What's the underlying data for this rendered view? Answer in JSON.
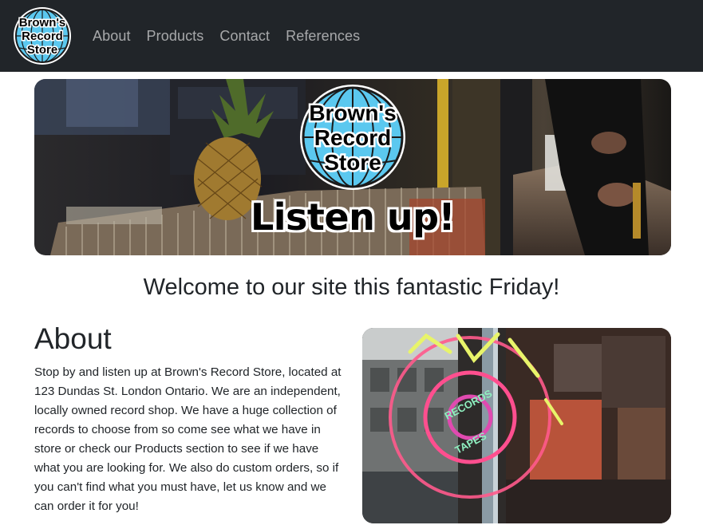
{
  "brand": {
    "logo_lines": [
      "Brown's",
      "Record",
      "Store"
    ],
    "colors": {
      "navbar": "#212529",
      "globe": "#5bc8ef",
      "text": "#212529",
      "link": "#9a9da0"
    }
  },
  "nav": {
    "items": [
      {
        "label": "About"
      },
      {
        "label": "Products"
      },
      {
        "label": "Contact"
      },
      {
        "label": "References"
      }
    ]
  },
  "hero": {
    "logo_lines": [
      "Brown's",
      "Record",
      "Store"
    ],
    "title": "Listen up!"
  },
  "welcome": {
    "heading": "Welcome to our site this fantastic Friday!"
  },
  "about": {
    "heading": "About",
    "body": "Stop by and listen up at Brown's Record Store, located at 123 Dundas St. London Ontario. We are an independent, locally owned record shop. We have a huge collection of records to choose from so come see what we have in store or check our Products section to see if we have what you are looking for. We also do custom orders, so if you can't find what you must have, let us know and we can order it for you!"
  },
  "sign_image": {
    "text_lines": [
      "RECORDS",
      "TAPES"
    ]
  }
}
